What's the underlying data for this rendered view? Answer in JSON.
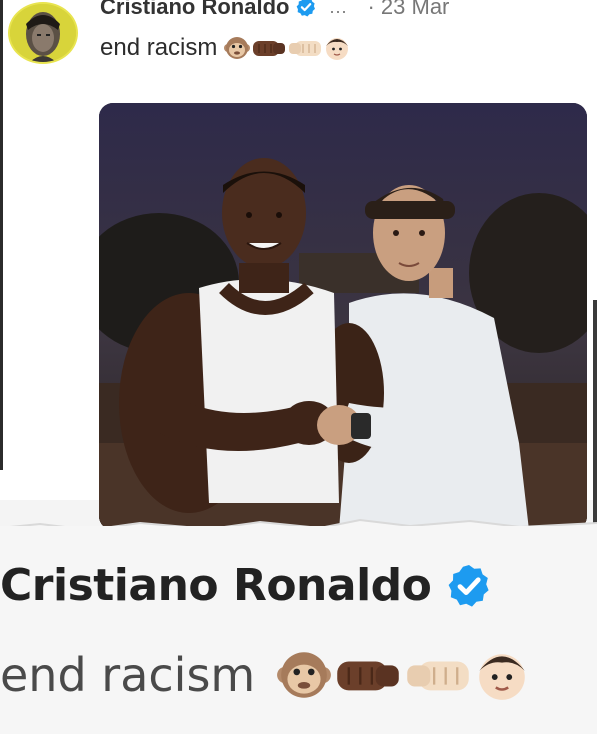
{
  "post": {
    "author_name": "Cristiano Ronaldo",
    "more_label": "...",
    "date": "· 23 Mar",
    "text": "end racism",
    "emojis": [
      "monkey-face-icon",
      "dark-fist-icon",
      "light-fist-icon",
      "boy-face-icon"
    ]
  },
  "caption_zoom": {
    "author_name": "Cristiano Ronaldo",
    "text": "end racism"
  },
  "colors": {
    "verified_blue": "#1d9bf0",
    "avatar_ring": "#d7d23b"
  }
}
